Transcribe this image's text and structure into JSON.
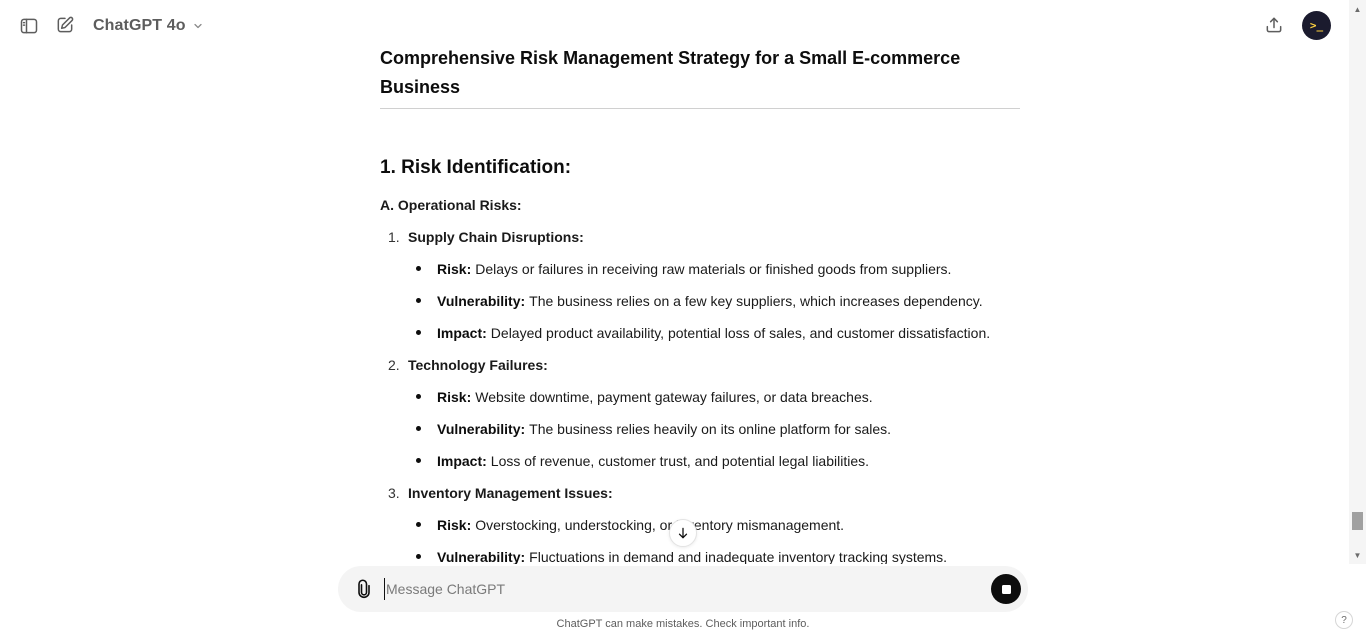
{
  "header": {
    "model_name": "ChatGPT 4o",
    "avatar_text": ">_"
  },
  "document": {
    "title": "Comprehensive Risk Management Strategy for a Small E-commerce Business",
    "section_heading": "1. Risk Identification:",
    "subsection_heading": "A. Operational Risks:",
    "groups": [
      {
        "number": "1.",
        "label": "Supply Chain Disruptions:",
        "bullets": [
          {
            "term": "Risk:",
            "text": "Delays or failures in receiving raw materials or finished goods from suppliers."
          },
          {
            "term": "Vulnerability:",
            "text": "The business relies on a few key suppliers, which increases dependency."
          },
          {
            "term": "Impact:",
            "text": "Delayed product availability, potential loss of sales, and customer dissatisfaction."
          }
        ]
      },
      {
        "number": "2.",
        "label": "Technology Failures:",
        "bullets": [
          {
            "term": "Risk:",
            "text": "Website downtime, payment gateway failures, or data breaches."
          },
          {
            "term": "Vulnerability:",
            "text": "The business relies heavily on its online platform for sales."
          },
          {
            "term": "Impact:",
            "text": "Loss of revenue, customer trust, and potential legal liabilities."
          }
        ]
      },
      {
        "number": "3.",
        "label": "Inventory Management Issues:",
        "bullets": [
          {
            "term": "Risk:",
            "text": "Overstocking, understocking, or inventory mismanagement."
          },
          {
            "term": "Vulnerability:",
            "text": "Fluctuations in demand and inadequate inventory tracking systems."
          }
        ]
      }
    ]
  },
  "composer": {
    "placeholder": "Message ChatGPT"
  },
  "footer": {
    "disclaimer": "ChatGPT can make mistakes. Check important info.",
    "help_label": "?"
  },
  "icons": {
    "sidebar_toggle": "sidebar-toggle-icon",
    "new_chat": "new-chat-icon",
    "model_chevron": "chevron-down-icon",
    "share": "share-icon",
    "scroll_down": "arrow-down-icon",
    "attach": "paperclip-icon",
    "stop": "stop-icon"
  }
}
